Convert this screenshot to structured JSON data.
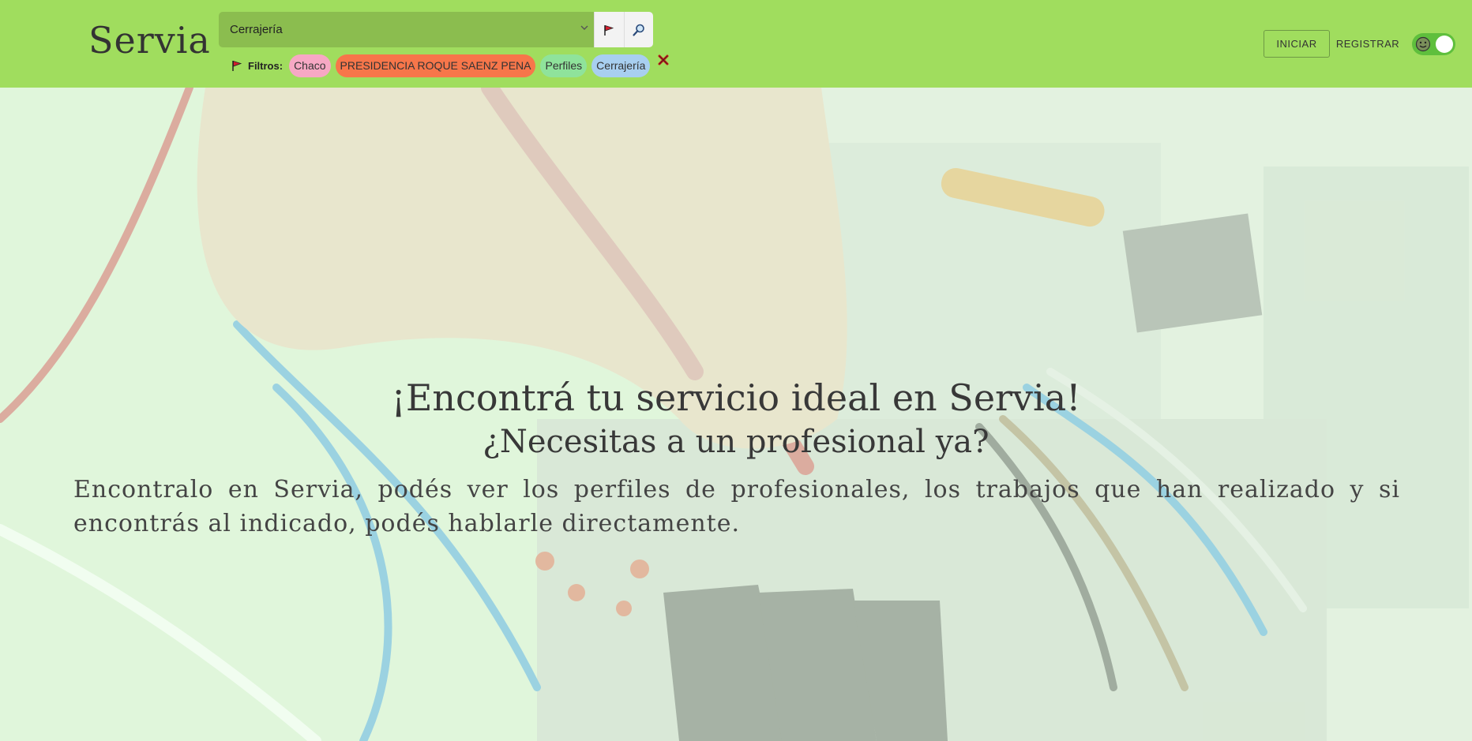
{
  "header": {
    "brand": "Servia",
    "search": {
      "selected_value": "Cerrajería",
      "flag_button_icon": "red-flag-icon",
      "search_button_icon": "magnifier-icon"
    },
    "filters": {
      "label": "Filtros:",
      "chips": [
        {
          "label": "Chaco",
          "color": "#f7a8c4"
        },
        {
          "label": "PRESIDENCIA ROQUE SAENZ PENA",
          "color": "#f7764a"
        },
        {
          "label": "Perfiles",
          "color": "#8fe39b"
        },
        {
          "label": "Cerrajería",
          "color": "#a8cff0"
        }
      ],
      "clear_icon": "red-x-icon"
    },
    "login_label": "INICIAR",
    "register_label": "REGISTRAR",
    "theme_toggle_icon": "smiley-icon"
  },
  "colors": {
    "header_bg": "#a0dd5e",
    "search_bg": "#8bbd4f",
    "toggle_bg": "#5fbf3d",
    "hero_overlay": "#e9fce6"
  },
  "hero": {
    "title": "¡Encontrá tu servicio ideal en Servia!",
    "subtitle": "¿Necesitas a un profesional ya?",
    "description": "Encontralo en Servia, podés ver los perfiles de profesionales, los trabajos que han realizado y si encontrás al indicado, podés hablarle directamente."
  }
}
